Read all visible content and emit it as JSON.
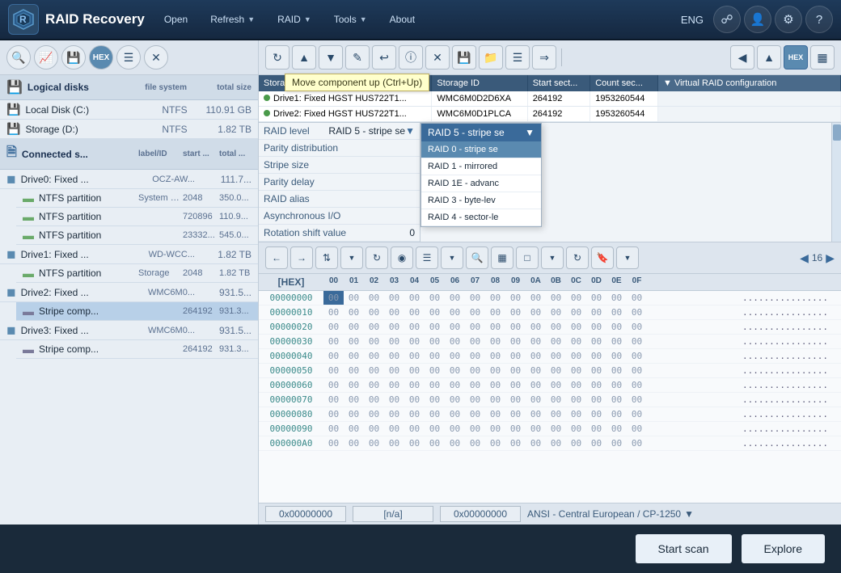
{
  "app": {
    "title": "RAID Recovery",
    "lang": "ENG"
  },
  "nav": {
    "open": "Open",
    "refresh": "Refresh",
    "raid": "RAID",
    "tools": "Tools",
    "about": "About"
  },
  "toolbar_left": {
    "buttons": [
      "search",
      "analyze",
      "open-drive",
      "hex",
      "list",
      "close"
    ]
  },
  "logical_disks": {
    "header": "Logical disks",
    "cols": {
      "name": "file system",
      "size": "total size"
    },
    "items": [
      {
        "name": "Local Disk (C:)",
        "fs": "NTFS",
        "size": "110.91 GB"
      },
      {
        "name": "Storage (D:)",
        "fs": "NTFS",
        "size": "1.82 TB"
      }
    ]
  },
  "connected": {
    "header": "Connected s...",
    "cols": {
      "label": "label/ID",
      "start": "start ...",
      "total": "total ..."
    },
    "items": [
      {
        "name": "Drive0: Fixed ...",
        "sub": "OCZ-AW...",
        "size": "111.7...",
        "children": [
          {
            "name": "NTFS partition",
            "label": "System R...",
            "start": "2048",
            "size": "350.0..."
          },
          {
            "name": "NTFS partition",
            "label": "",
            "start": "720896",
            "size": "110.9..."
          },
          {
            "name": "NTFS partition",
            "label": "",
            "start": "23332...",
            "size": "545.0..."
          }
        ]
      },
      {
        "name": "Drive1: Fixed ...",
        "sub": "WD-WCC...",
        "size": "1.82 TB",
        "children": [
          {
            "name": "NTFS partition",
            "label": "Storage",
            "start": "2048",
            "size": "1.82 TB"
          }
        ]
      },
      {
        "name": "Drive2: Fixed ...",
        "sub": "WMC6M0...",
        "size": "931.5...",
        "children": [
          {
            "name": "Stripe comp...",
            "label": "",
            "start": "264192",
            "size": "931.3...",
            "selected": true
          }
        ]
      },
      {
        "name": "Drive3: Fixed ...",
        "sub": "WMC6M0...",
        "size": "931.5...",
        "children": [
          {
            "name": "Stripe comp...",
            "label": "",
            "start": "264192",
            "size": "931.3..."
          }
        ]
      }
    ]
  },
  "raid_toolbar": {
    "buttons": [
      "refresh-rotation",
      "up",
      "down",
      "edit",
      "undo",
      "info",
      "remove",
      "save-set",
      "open-set",
      "layers",
      "export"
    ]
  },
  "raid_table": {
    "cols": [
      "Storage name",
      "Storage ID",
      "Start sect...",
      "Count sec...",
      "Virtual RAID configuration"
    ],
    "rows": [
      {
        "name": "Drive1: Fixed HGST HUS722T1...",
        "id": "WMC6M0D2D6XA",
        "start": "264192",
        "count": "1953260544"
      },
      {
        "name": "Drive2: Fixed HGST HUS722T1...",
        "id": "WMC6M0D1PLCA",
        "start": "264192",
        "count": "1953260544"
      }
    ]
  },
  "raid_config": {
    "properties": [
      {
        "label": "RAID level",
        "value": "RAID 5 - stripe se"
      },
      {
        "label": "Parity distribution",
        "value": ""
      },
      {
        "label": "Stripe size",
        "value": ""
      },
      {
        "label": "Parity delay",
        "value": ""
      },
      {
        "label": "RAID alias",
        "value": ""
      },
      {
        "label": "Asynchronous I/O",
        "value": ""
      },
      {
        "label": "Rotation shift value",
        "value": "0"
      }
    ],
    "dropdown_options": [
      {
        "label": "RAID 0 - stripe se",
        "highlighted": true
      },
      {
        "label": "RAID 1 - mirrored"
      },
      {
        "label": "RAID 1E - advanc"
      },
      {
        "label": "RAID 3 - byte-lev"
      },
      {
        "label": "RAID 4 - sector-le"
      }
    ]
  },
  "hex": {
    "page_label": "16",
    "columns": [
      "00",
      "01",
      "02",
      "03",
      "04",
      "05",
      "06",
      "07",
      "08",
      "09",
      "0A",
      "0B",
      "0C",
      "0D",
      "0E",
      "0F"
    ],
    "rows": [
      {
        "addr": "00000000",
        "bytes": [
          "00",
          "00",
          "00",
          "00",
          "00",
          "00",
          "00",
          "00",
          "00",
          "00",
          "00",
          "00",
          "00",
          "00",
          "00",
          "00"
        ],
        "selected_idx": 0
      },
      {
        "addr": "00000010",
        "bytes": [
          "00",
          "00",
          "00",
          "00",
          "00",
          "00",
          "00",
          "00",
          "00",
          "00",
          "00",
          "00",
          "00",
          "00",
          "00",
          "00"
        ]
      },
      {
        "addr": "00000020",
        "bytes": [
          "00",
          "00",
          "00",
          "00",
          "00",
          "00",
          "00",
          "00",
          "00",
          "00",
          "00",
          "00",
          "00",
          "00",
          "00",
          "00"
        ]
      },
      {
        "addr": "00000030",
        "bytes": [
          "00",
          "00",
          "00",
          "00",
          "00",
          "00",
          "00",
          "00",
          "00",
          "00",
          "00",
          "00",
          "00",
          "00",
          "00",
          "00"
        ]
      },
      {
        "addr": "00000040",
        "bytes": [
          "00",
          "00",
          "00",
          "00",
          "00",
          "00",
          "00",
          "00",
          "00",
          "00",
          "00",
          "00",
          "00",
          "00",
          "00",
          "00"
        ]
      },
      {
        "addr": "00000050",
        "bytes": [
          "00",
          "00",
          "00",
          "00",
          "00",
          "00",
          "00",
          "00",
          "00",
          "00",
          "00",
          "00",
          "00",
          "00",
          "00",
          "00"
        ]
      },
      {
        "addr": "00000060",
        "bytes": [
          "00",
          "00",
          "00",
          "00",
          "00",
          "00",
          "00",
          "00",
          "00",
          "00",
          "00",
          "00",
          "00",
          "00",
          "00",
          "00"
        ]
      },
      {
        "addr": "00000070",
        "bytes": [
          "00",
          "00",
          "00",
          "00",
          "00",
          "00",
          "00",
          "00",
          "00",
          "00",
          "00",
          "00",
          "00",
          "00",
          "00",
          "00"
        ]
      },
      {
        "addr": "00000080",
        "bytes": [
          "00",
          "00",
          "00",
          "00",
          "00",
          "00",
          "00",
          "00",
          "00",
          "00",
          "00",
          "00",
          "00",
          "00",
          "00",
          "00"
        ]
      },
      {
        "addr": "00000090",
        "bytes": [
          "00",
          "00",
          "00",
          "00",
          "00",
          "00",
          "00",
          "00",
          "00",
          "00",
          "00",
          "00",
          "00",
          "00",
          "00",
          "00"
        ]
      },
      {
        "addr": "000000A0",
        "bytes": [
          "00",
          "00",
          "00",
          "00",
          "00",
          "00",
          "00",
          "00",
          "00",
          "00",
          "00",
          "00",
          "00",
          "00",
          "00",
          "00"
        ]
      }
    ],
    "statusbar": {
      "offset": "0x00000000",
      "value": "[n/a]",
      "address": "0x00000000",
      "encoding": "ANSI - Central European / CP-1250"
    }
  },
  "tooltip": {
    "text": "Move component up (Ctrl+Up)"
  },
  "bottom": {
    "scan_label": "Start scan",
    "explore_label": "Explore"
  }
}
